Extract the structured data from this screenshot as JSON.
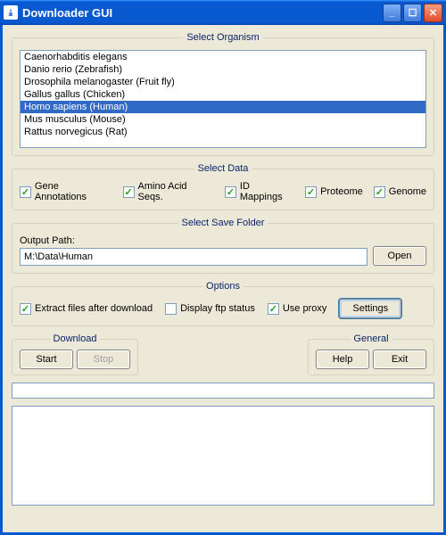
{
  "window": {
    "title": "Downloader GUI"
  },
  "organism": {
    "legend": "Select Organism",
    "items": [
      "Caenorhabditis elegans",
      "Danio rerio (Zebrafish)",
      "Drosophila melanogaster (Fruit fly)",
      "Gallus gallus (Chicken)",
      "Homo sapiens (Human)",
      "Mus musculus (Mouse)",
      "Rattus norvegicus (Rat)"
    ],
    "selected_index": 4
  },
  "data": {
    "legend": "Select Data",
    "gene_annotations": {
      "label": "Gene Annotations",
      "checked": true
    },
    "amino_acid_seqs": {
      "label": "Amino Acid Seqs.",
      "checked": true
    },
    "id_mappings": {
      "label": "ID Mappings",
      "checked": true
    },
    "proteome": {
      "label": "Proteome",
      "checked": true
    },
    "genome": {
      "label": "Genome",
      "checked": true
    }
  },
  "save": {
    "legend": "Select Save Folder",
    "path_label": "Output Path:",
    "path_value": "M:\\Data\\Human",
    "open_label": "Open"
  },
  "options": {
    "legend": "Options",
    "extract": {
      "label": "Extract files after download",
      "checked": true
    },
    "display_ftp": {
      "label": "Display ftp status",
      "checked": false
    },
    "use_proxy": {
      "label": "Use proxy",
      "checked": true
    },
    "settings_label": "Settings"
  },
  "download": {
    "legend": "Download",
    "start_label": "Start",
    "stop_label": "Stop"
  },
  "general": {
    "legend": "General",
    "help_label": "Help",
    "exit_label": "Exit"
  }
}
